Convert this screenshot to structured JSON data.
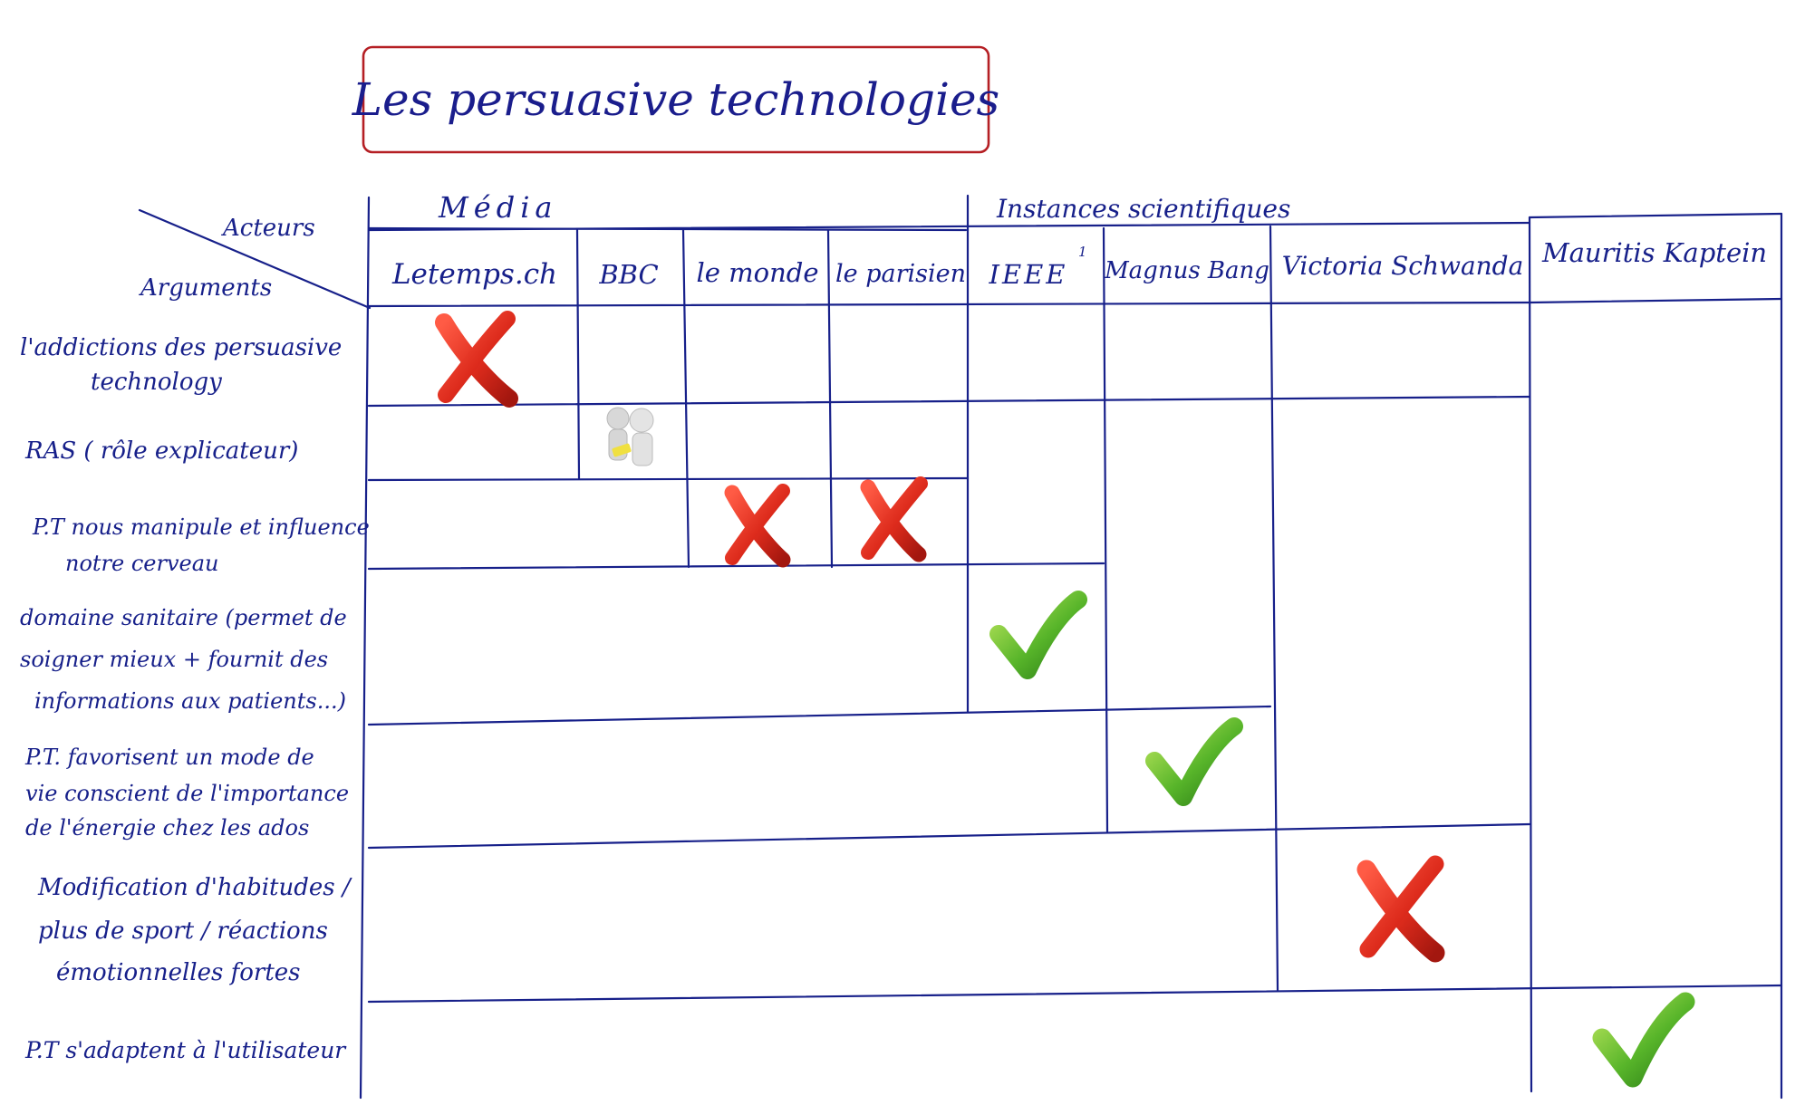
{
  "title": "Les persuasive technologies",
  "header": {
    "corner_top": "Acteurs",
    "corner_bottom": "Arguments",
    "groups": [
      {
        "label": "Média"
      },
      {
        "label": "Instances scientifiques"
      }
    ],
    "actors": [
      {
        "label": "Letemps.ch"
      },
      {
        "label": "BBC"
      },
      {
        "label": "le monde"
      },
      {
        "label": "le parisien"
      },
      {
        "label": "IEEE",
        "superscript": "1"
      },
      {
        "label": "Magnus Bang"
      },
      {
        "label": "Victoria Schwanda"
      },
      {
        "label": "Mauritis Kaptein"
      }
    ]
  },
  "rows": [
    {
      "lines": [
        "l'addictions des persuasive",
        "technology"
      ]
    },
    {
      "lines": [
        "RAS ( rôle explicateur)"
      ]
    },
    {
      "lines": [
        "P.T nous manipule et influence",
        "notre cerveau"
      ]
    },
    {
      "lines": [
        "domaine sanitaire (permet de",
        "soigner mieux + fournit des",
        "informations aux patients...)"
      ]
    },
    {
      "lines": [
        "P.T. favorisent un mode de",
        "vie conscient de l'importance",
        "de l'énergie chez les ados"
      ]
    },
    {
      "lines": [
        "Modification d'habitudes /",
        "plus de sport / réactions",
        "émotionnelles fortes"
      ]
    },
    {
      "lines": [
        "P.T s'adaptent à l'utilisateur"
      ]
    }
  ],
  "marks": [
    {
      "row": 0,
      "actor": 0,
      "symbol": "cross",
      "color": "#d62a1e"
    },
    {
      "row": 1,
      "actor": 1,
      "symbol": "figures-icon",
      "color": "#c8c8c8"
    },
    {
      "row": 2,
      "actor": 2,
      "symbol": "cross",
      "color": "#d62a1e"
    },
    {
      "row": 2,
      "actor": 3,
      "symbol": "cross",
      "color": "#d62a1e"
    },
    {
      "row": 3,
      "actor": 4,
      "symbol": "check",
      "color": "#3f9a1e"
    },
    {
      "row": 4,
      "actor": 5,
      "symbol": "check",
      "color": "#3f9a1e"
    },
    {
      "row": 5,
      "actor": 6,
      "symbol": "cross",
      "color": "#d62a1e"
    },
    {
      "row": 6,
      "actor": 7,
      "symbol": "check",
      "color": "#3f9a1e"
    }
  ],
  "colors": {
    "ink": "#17208a",
    "title_box": "#b51f24",
    "cross": "#d62a1e",
    "check": "#3f9a1e"
  }
}
